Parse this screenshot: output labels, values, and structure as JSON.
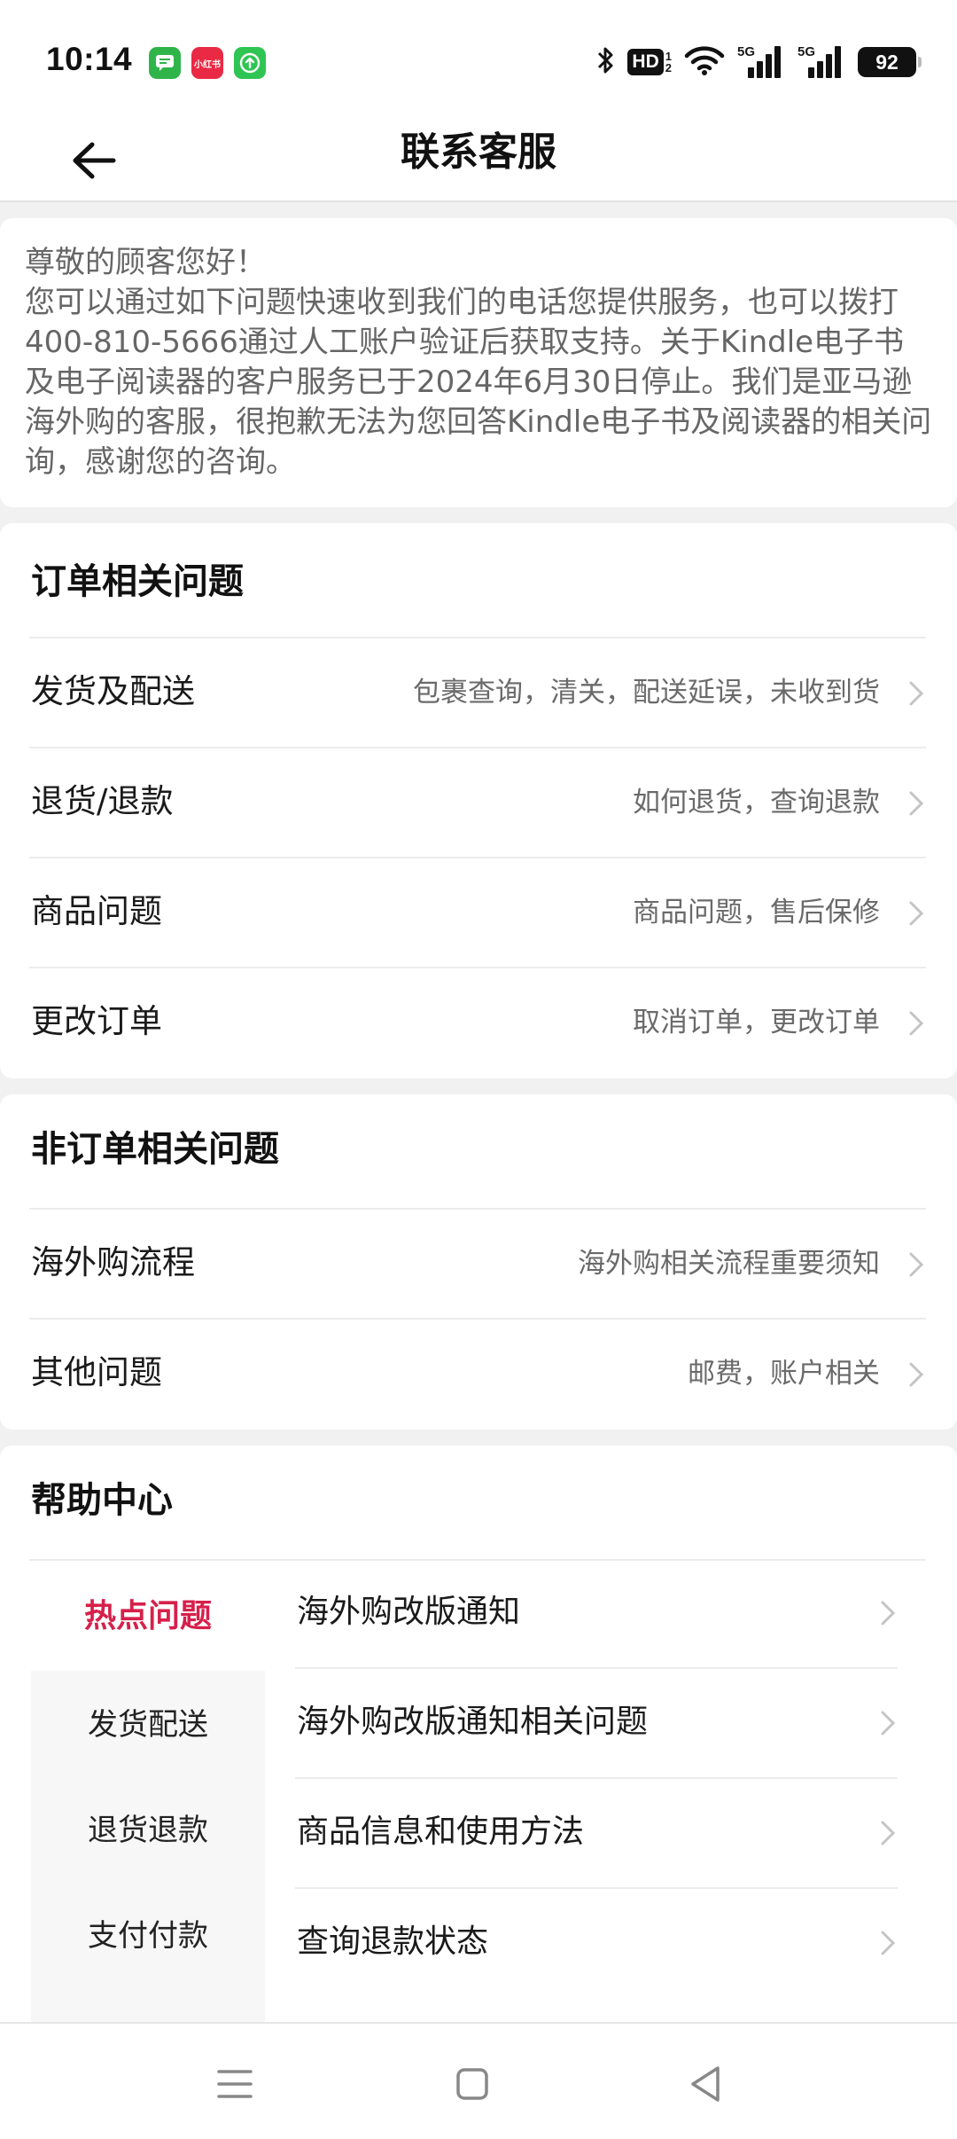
{
  "status_bar": {
    "time": "10:14",
    "apps": [
      {
        "name": "messages-app-icon",
        "color": "#2fb44a",
        "glyph": "▬"
      },
      {
        "name": "xiaohongshu-app-icon",
        "color": "#ea2a44",
        "glyph": "小红书"
      },
      {
        "name": "upload-app-icon",
        "color": "#2ec552",
        "glyph": "⇧"
      }
    ],
    "hd_label": "HD",
    "hd_sub": "1\n2",
    "signal_1_label": "5G",
    "signal_2_label": "5G",
    "battery": "92"
  },
  "header": {
    "title": "联系客服",
    "back_icon": "arrow-left-icon"
  },
  "notice": {
    "text": "尊敬的顾客您好！\n您可以通过如下问题快速收到我们的电话您提供服务，也可以拨打400-810-5666通过人工账户验证后获取支持。关于Kindle电子书及电子阅读器的客户服务已于2024年6月30日停止。我们是亚马逊海外购的客服，很抱歉无法为您回答Kindle电子书及阅读器的相关问询，感谢您的咨询。"
  },
  "order_section": {
    "title": "订单相关问题",
    "rows": [
      {
        "label": "发货及配送",
        "desc": "包裹查询，清关，配送延误，未收到货"
      },
      {
        "label": "退货/退款",
        "desc": "如何退货，查询退款"
      },
      {
        "label": "商品问题",
        "desc": "商品问题，售后保修"
      },
      {
        "label": "更改订单",
        "desc": "取消订单，更改订单"
      }
    ]
  },
  "non_order_section": {
    "title": "非订单相关问题",
    "rows": [
      {
        "label": "海外购流程",
        "desc": "海外购相关流程重要须知"
      },
      {
        "label": "其他问题",
        "desc": "邮费，账户相关"
      }
    ]
  },
  "help_center": {
    "title": "帮助中心",
    "tabs": [
      {
        "label": "热点问题",
        "active": true
      },
      {
        "label": "发货配送",
        "active": false
      },
      {
        "label": "退货退款",
        "active": false
      },
      {
        "label": "支付付款",
        "active": false
      }
    ],
    "items": [
      {
        "label": "海外购改版通知"
      },
      {
        "label": "海外购改版通知相关问题"
      },
      {
        "label": "商品信息和使用方法"
      },
      {
        "label": "查询退款状态"
      }
    ]
  },
  "nav_bar": {
    "icons": [
      "menu-icon",
      "home-square-icon",
      "back-triangle-icon"
    ]
  },
  "colors": {
    "accent": "#d6204b",
    "background": "#f1f1f1",
    "card": "#ffffff",
    "secondary_text": "#6a6a6a"
  }
}
